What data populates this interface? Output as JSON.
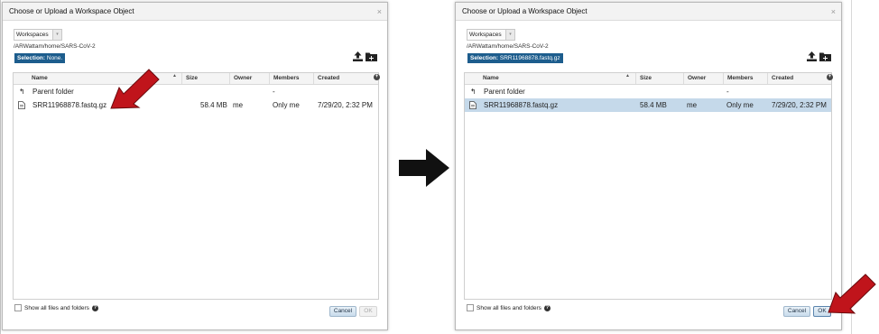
{
  "dialogs": [
    {
      "title": "Choose or Upload a Workspace Object",
      "close": "×",
      "type_select": "Workspaces",
      "path": "/ARWattam/home/SARS-CoV-2",
      "selection_label": "Selection:",
      "selection_value": "None.",
      "columns": [
        "Name",
        "Size",
        "Owner",
        "Members",
        "Created"
      ],
      "rows": [
        {
          "icon": "↰",
          "name": "Parent folder",
          "size": "",
          "owner": "",
          "members": "-",
          "created": ""
        },
        {
          "icon": "file",
          "name": "SRR11968878.fastq.gz",
          "size": "58.4 MB",
          "owner": "me",
          "members": "Only me",
          "created": "7/29/20, 2:32 PM"
        }
      ],
      "show_all_label": "Show all files and folders",
      "help_glyph": "?",
      "cancel": "Cancel",
      "ok": "OK",
      "ok_enabled": false
    },
    {
      "title": "Choose or Upload a Workspace Object",
      "close": "×",
      "type_select": "Workspaces",
      "path": "/ARWattam/home/SARS-CoV-2",
      "selection_label": "Selection:",
      "selection_value": "SRR11968878.fastq.gz",
      "columns": [
        "Name",
        "Size",
        "Owner",
        "Members",
        "Created"
      ],
      "rows": [
        {
          "icon": "↰",
          "name": "Parent folder",
          "size": "",
          "owner": "",
          "members": "-",
          "created": ""
        },
        {
          "icon": "file",
          "name": "SRR11968878.fastq.gz",
          "size": "58.4 MB",
          "owner": "me",
          "members": "Only me",
          "created": "7/29/20, 2:32 PM",
          "selected": true
        }
      ],
      "show_all_label": "Show all files and folders",
      "help_glyph": "?",
      "cancel": "Cancel",
      "ok": "OK",
      "ok_enabled": true
    }
  ],
  "colors": {
    "selection_badge": "#1d5d8d",
    "selected_row": "#c5d9ea",
    "annotation_arrow": "#c0141b"
  }
}
